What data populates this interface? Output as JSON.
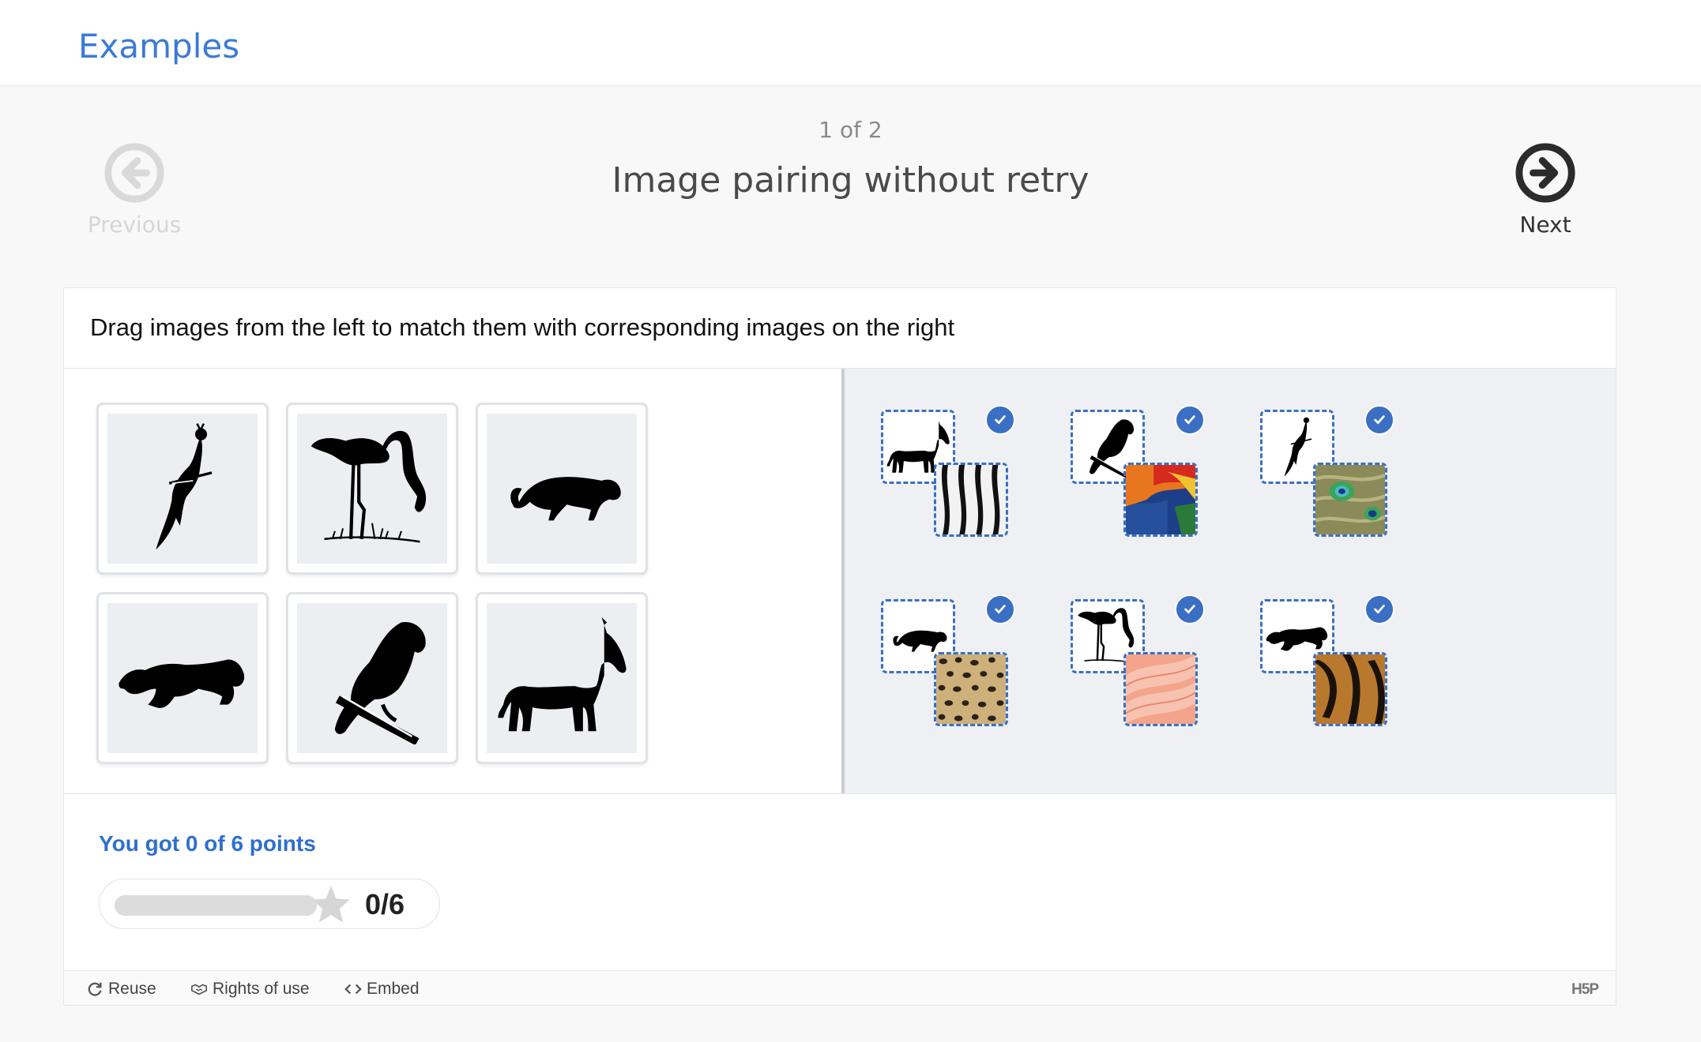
{
  "header": {
    "brand": "Examples"
  },
  "slide": {
    "counter": "1 of 2",
    "title": "Image pairing without retry"
  },
  "nav": {
    "previous_label": "Previous",
    "next_label": "Next"
  },
  "task": {
    "instruction": "Drag images from the left to match them with corresponding images on the right"
  },
  "cards": [
    {
      "animal": "peacock"
    },
    {
      "animal": "flamingo"
    },
    {
      "animal": "cheetah"
    },
    {
      "animal": "tiger"
    },
    {
      "animal": "parrot"
    },
    {
      "animal": "zebra"
    }
  ],
  "pairs": [
    {
      "animal": "zebra",
      "texture": "zebra-stripes"
    },
    {
      "animal": "parrot",
      "texture": "macaw-feathers"
    },
    {
      "animal": "peacock",
      "texture": "peacock-feathers"
    },
    {
      "animal": "cheetah",
      "texture": "leopard-spots"
    },
    {
      "animal": "flamingo",
      "texture": "flamingo-feathers"
    },
    {
      "animal": "tiger",
      "texture": "tiger-stripes"
    }
  ],
  "score": {
    "text": "You got 0 of 6 points",
    "value": "0/6",
    "fraction": 0
  },
  "footer": {
    "reuse": "Reuse",
    "rights": "Rights of use",
    "embed": "Embed",
    "logo": "H5P"
  },
  "colors": {
    "accent": "#3a6fc4",
    "brand": "#3a7bd5",
    "right_panel": "#eef0f4"
  }
}
